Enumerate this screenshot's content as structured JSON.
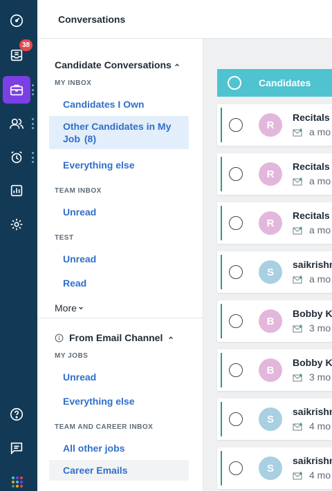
{
  "colors": {
    "rail": "#123a57",
    "rail_active": "#7b3fe4",
    "accent_teal": "#4fc3cf",
    "link": "#2f6fca",
    "badge": "#e5484d",
    "row_bar": "#2e9b73"
  },
  "rail": {
    "items": [
      {
        "icon": "dashboard-gauge-icon"
      },
      {
        "icon": "inbox-icon",
        "badge": "38"
      },
      {
        "icon": "briefcase-icon",
        "active": true
      },
      {
        "icon": "people-icon"
      },
      {
        "icon": "alarm-clock-icon"
      },
      {
        "icon": "report-chart-icon"
      },
      {
        "icon": "settings-gear-icon"
      }
    ],
    "bottom": [
      {
        "icon": "help-icon"
      },
      {
        "icon": "chat-icon"
      },
      {
        "icon": "apps-grid-icon"
      }
    ]
  },
  "header": {
    "title": "Conversations"
  },
  "sidebar": {
    "candidate_section": {
      "title": "Candidate Conversations",
      "my_inbox_label": "MY INBOX",
      "my_inbox_items": [
        {
          "label": "Candidates I Own"
        },
        {
          "label": "Other Candidates in My Job",
          "count": "(8)",
          "selected": true
        },
        {
          "label": "Everything else"
        }
      ],
      "team_inbox_label": "TEAM INBOX",
      "team_inbox_items": [
        {
          "label": "Unread"
        }
      ],
      "test_label": "TEST",
      "test_items": [
        {
          "label": "Unread"
        },
        {
          "label": "Read"
        }
      ],
      "more_label": "More"
    },
    "email_section": {
      "title": "From Email Channel",
      "my_jobs_label": "MY JOBS",
      "my_jobs_items": [
        {
          "label": "Unread"
        },
        {
          "label": "Everything else"
        }
      ],
      "career_label": "TEAM AND CAREER INBOX",
      "career_items": [
        {
          "label": "All other jobs"
        },
        {
          "label": "Career Emails"
        }
      ]
    }
  },
  "list": {
    "header_label": "Candidates",
    "rows": [
      {
        "initial": "R",
        "name": "Recitals",
        "time": "a mo",
        "avatar_color": "#e3b7dc"
      },
      {
        "initial": "R",
        "name": "Recitals",
        "time": "a mo",
        "avatar_color": "#e3b7dc"
      },
      {
        "initial": "R",
        "name": "Recitals",
        "time": "a mo",
        "avatar_color": "#e3b7dc"
      },
      {
        "initial": "S",
        "name": "saikrishn",
        "time": "a mo",
        "avatar_color": "#a9cfe2"
      },
      {
        "initial": "B",
        "name": "Bobby Ki",
        "time": "3 mo",
        "avatar_color": "#e3b7dc"
      },
      {
        "initial": "B",
        "name": "Bobby Ki",
        "time": "3 mo",
        "avatar_color": "#e3b7dc"
      },
      {
        "initial": "S",
        "name": "saikrishn",
        "time": "4 mo",
        "avatar_color": "#a9cfe2"
      },
      {
        "initial": "S",
        "name": "saikrishn",
        "time": "4 mo",
        "avatar_color": "#a9cfe2"
      }
    ]
  }
}
